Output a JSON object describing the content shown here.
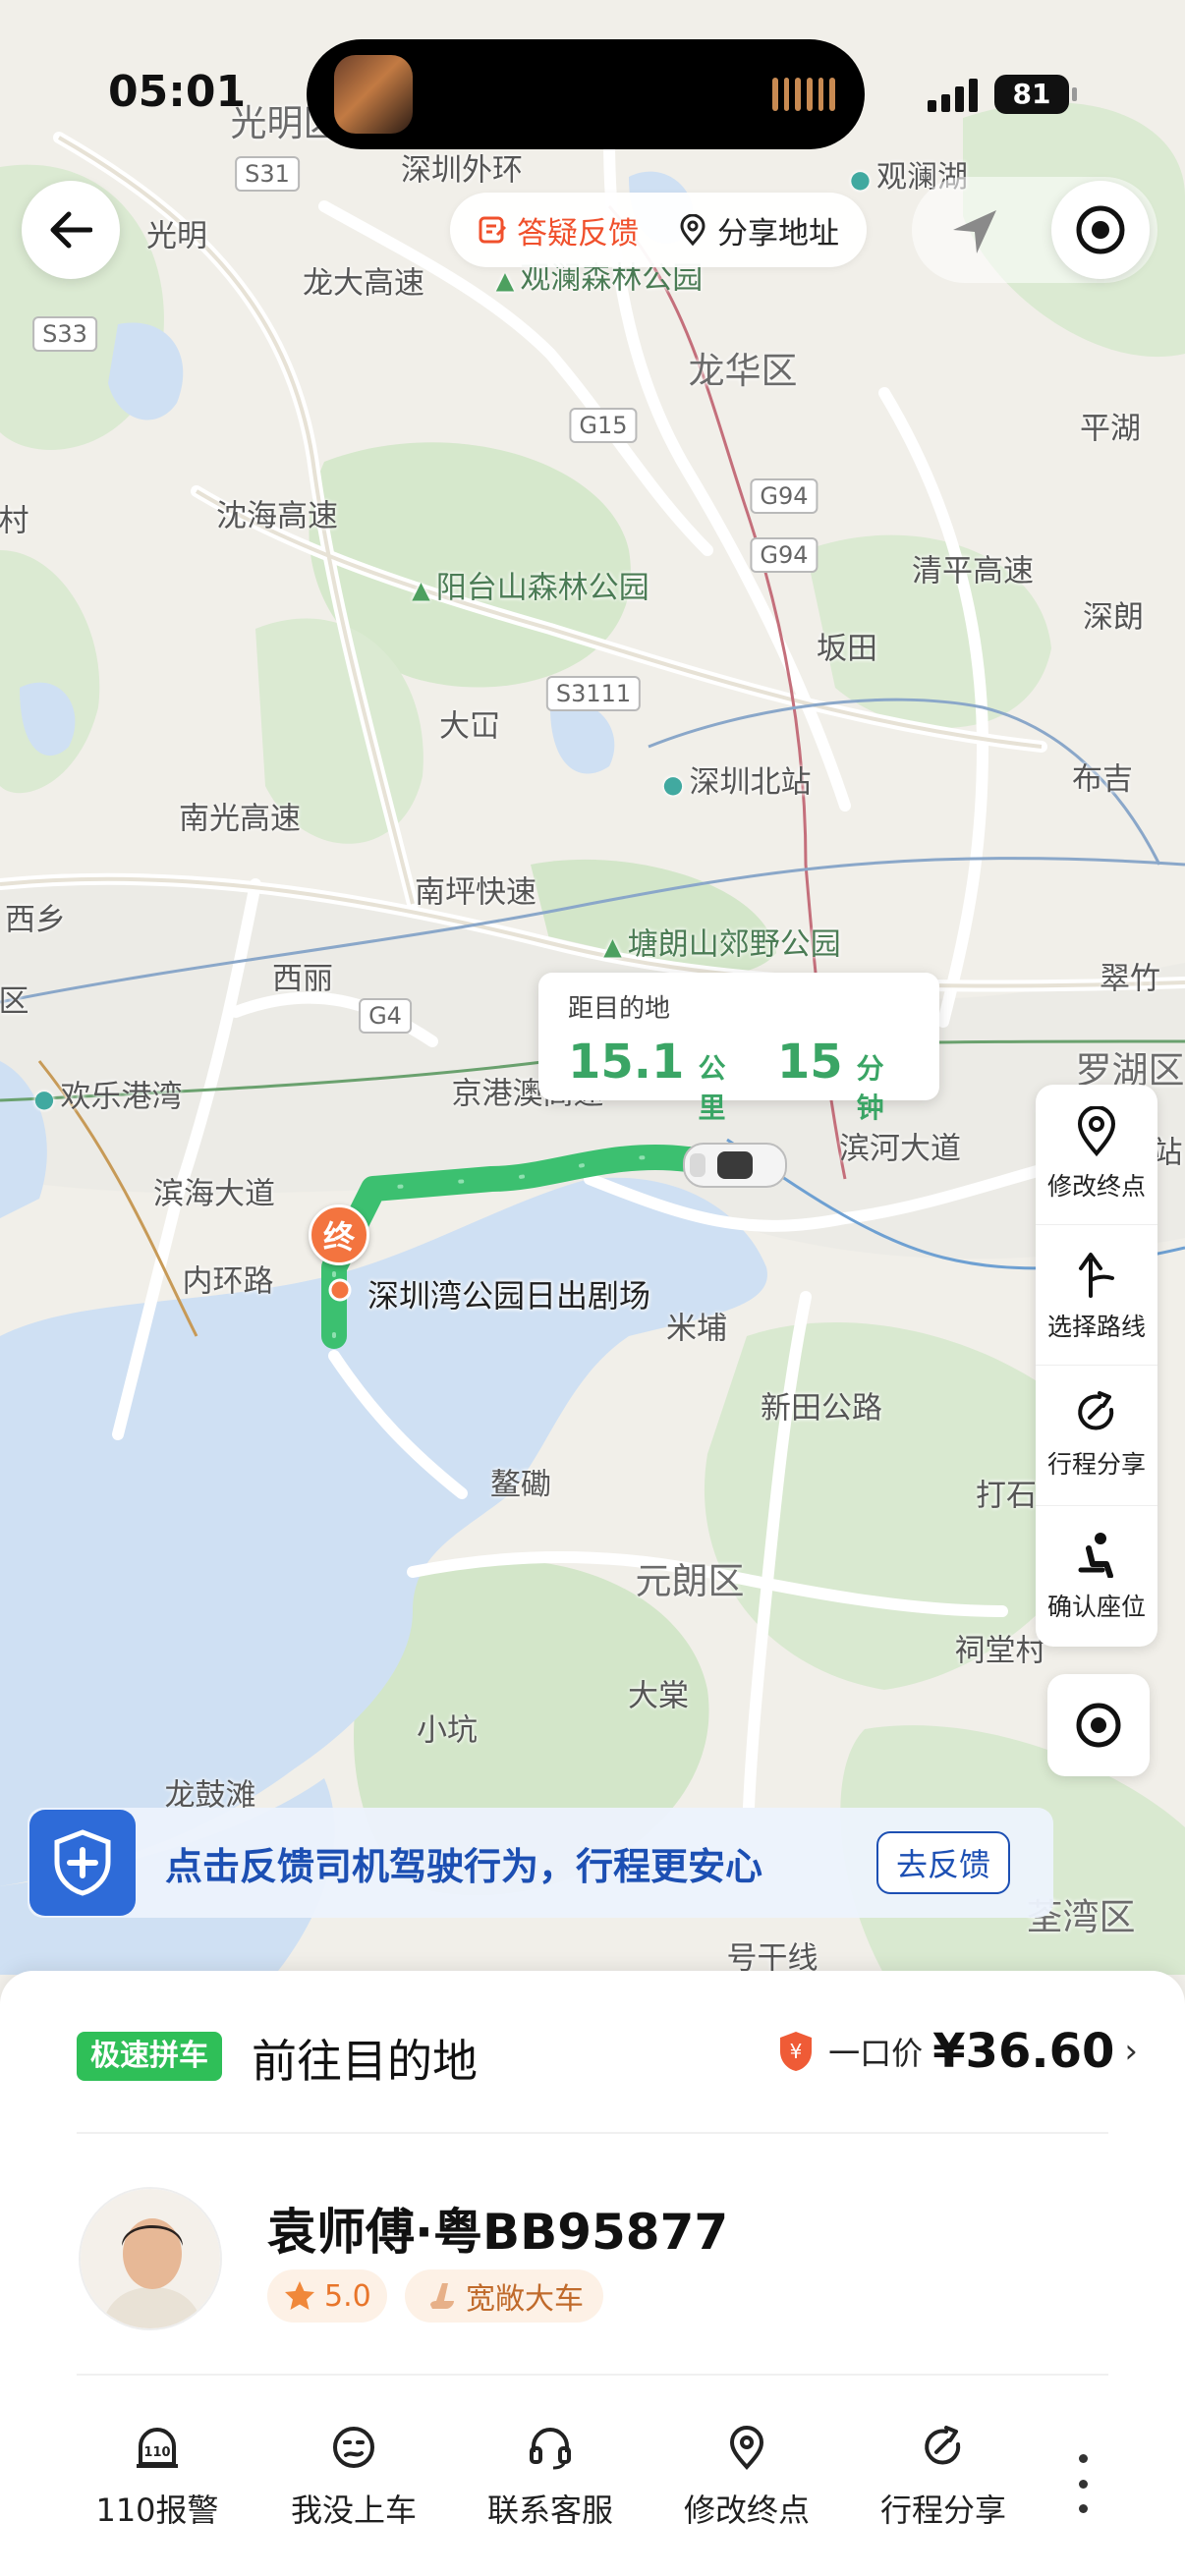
{
  "status_bar": {
    "time": "05:01",
    "battery": "81"
  },
  "top_bar": {
    "feedback_label": "答疑反馈",
    "share_label": "分享地址"
  },
  "map": {
    "labels": [
      {
        "text": "光明区",
        "style": "big"
      },
      {
        "text": "光明",
        "style": "normal"
      },
      {
        "text": "深圳外环",
        "style": "normal"
      },
      {
        "text": "观澜湖",
        "style": "poi"
      },
      {
        "text": "观澜森林公园",
        "style": "park"
      },
      {
        "text": "龙大高速",
        "style": "normal"
      },
      {
        "text": "龙华区",
        "style": "big"
      },
      {
        "text": "平湖",
        "style": "normal"
      },
      {
        "text": "沈海高速",
        "style": "normal"
      },
      {
        "text": "清平高速",
        "style": "normal"
      },
      {
        "text": "阳台山森林公园",
        "style": "park"
      },
      {
        "text": "坂田",
        "style": "normal"
      },
      {
        "text": "深朗",
        "style": "normal"
      },
      {
        "text": "大冚",
        "style": "normal"
      },
      {
        "text": "深圳北站",
        "style": "poi"
      },
      {
        "text": "布吉",
        "style": "normal"
      },
      {
        "text": "南光高速",
        "style": "normal"
      },
      {
        "text": "西乡",
        "style": "normal"
      },
      {
        "text": "南坪快速",
        "style": "normal"
      },
      {
        "text": "塘朗山郊野公园",
        "style": "park"
      },
      {
        "text": "西丽",
        "style": "normal"
      },
      {
        "text": "翠竹",
        "style": "normal"
      },
      {
        "text": "欢乐港湾",
        "style": "poi"
      },
      {
        "text": "京港澳高速",
        "style": "normal"
      },
      {
        "text": "罗湖区",
        "style": "big"
      },
      {
        "text": "滨海大道",
        "style": "normal"
      },
      {
        "text": "滨河大道",
        "style": "normal"
      },
      {
        "text": "内环路",
        "style": "normal"
      },
      {
        "text": "米埔",
        "style": "normal"
      },
      {
        "text": "新田公路",
        "style": "normal"
      },
      {
        "text": "鳌磡",
        "style": "normal"
      },
      {
        "text": "打石",
        "style": "normal"
      },
      {
        "text": "元朗区",
        "style": "big"
      },
      {
        "text": "大棠",
        "style": "normal"
      },
      {
        "text": "小坑",
        "style": "normal"
      },
      {
        "text": "祠堂村",
        "style": "normal"
      },
      {
        "text": "龙鼓滩",
        "style": "normal"
      },
      {
        "text": "荃湾区",
        "style": "big"
      },
      {
        "text": "号干线",
        "style": "normal"
      },
      {
        "text": "村",
        "style": "normal"
      },
      {
        "text": "区",
        "style": "normal"
      },
      {
        "text": "站",
        "style": "normal"
      }
    ],
    "shields": [
      "S31",
      "S33",
      "G15",
      "G94",
      "G94",
      "S3111",
      "G4"
    ]
  },
  "eta": {
    "title": "距目的地",
    "distance": "15.1",
    "distance_unit": "公里",
    "time": "15",
    "time_unit": "分钟"
  },
  "destination": {
    "badge": "终",
    "name": "深圳湾公园日出剧场"
  },
  "side_tools": [
    {
      "label": "修改终点",
      "icon": "pin-icon"
    },
    {
      "label": "选择路线",
      "icon": "route-turn-icon"
    },
    {
      "label": "行程分享",
      "icon": "share-arrow-icon"
    },
    {
      "label": "确认座位",
      "icon": "seat-icon"
    }
  ],
  "banner": {
    "text": "点击反馈司机驾驶行为，行程更安心",
    "button": "去反馈"
  },
  "trip": {
    "type": "极速拼车",
    "status": "前往目的地",
    "price_label": "一口价",
    "price": "¥36.60",
    "currency_badge": "¥"
  },
  "driver": {
    "name": "袁师傅·粤BB95877",
    "rating": "5.0",
    "car_tag": "宽敞大车"
  },
  "actions": [
    {
      "label": "110报警",
      "icon": "police-110-icon",
      "badge": "110"
    },
    {
      "label": "我没上车",
      "icon": "confused-face-icon"
    },
    {
      "label": "联系客服",
      "icon": "headset-icon"
    },
    {
      "label": "修改终点",
      "icon": "pin-icon"
    },
    {
      "label": "行程分享",
      "icon": "share-arrow-icon"
    }
  ],
  "colors": {
    "route": "#3cc070",
    "accent_orange": "#f0502c",
    "banner_blue": "#2e6bd8",
    "ride_type_green": "#2fbf58"
  }
}
